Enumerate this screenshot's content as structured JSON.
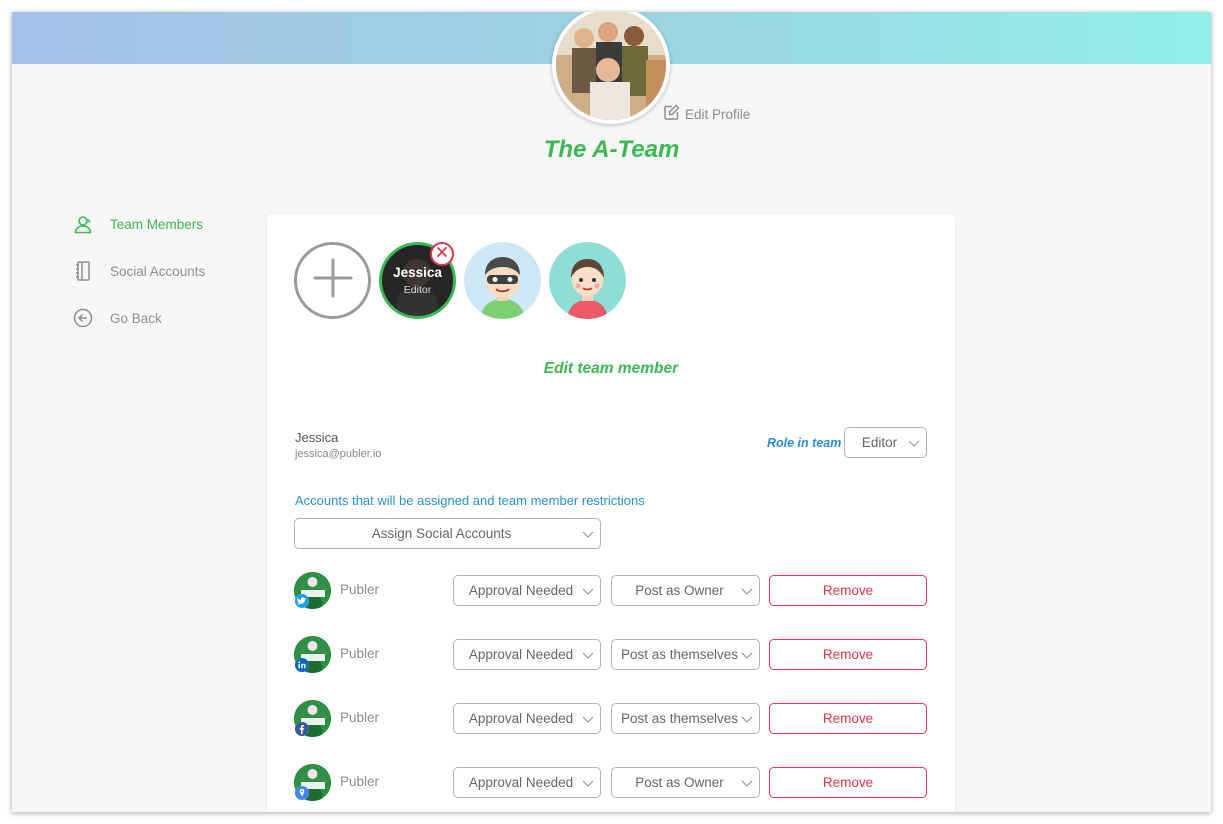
{
  "header": {
    "team_name": "The A-Team",
    "edit_profile_label": "Edit Profile"
  },
  "sidebar": {
    "items": [
      {
        "label": "Team Members",
        "icon": "user-icon",
        "active": true
      },
      {
        "label": "Social Accounts",
        "icon": "notebook-icon",
        "active": false
      },
      {
        "label": "Go Back",
        "icon": "arrow-left-circle-icon",
        "active": false
      }
    ]
  },
  "members": {
    "add_icon": "plus-circle-icon",
    "selected": {
      "name": "Jessica",
      "role": "Editor"
    }
  },
  "editor": {
    "title": "Edit team member",
    "member_name": "Jessica",
    "member_email": "jessica@publer.io",
    "role_label": "Role in team",
    "role_value": "Editor",
    "assign_label": "Accounts that will be assigned and team member restrictions",
    "assign_placeholder": "Assign Social Accounts"
  },
  "accounts": [
    {
      "name": "Publer",
      "network": "twitter-icon",
      "approval": "Approval Needed",
      "post_as": "Post as Owner",
      "remove_label": "Remove"
    },
    {
      "name": "Publer",
      "network": "linkedin-icon",
      "approval": "Approval Needed",
      "post_as": "Post as themselves",
      "remove_label": "Remove"
    },
    {
      "name": "Publer",
      "network": "facebook-icon",
      "approval": "Approval Needed",
      "post_as": "Post as themselves",
      "remove_label": "Remove"
    },
    {
      "name": "Publer",
      "network": "google-my-business-icon",
      "approval": "Approval Needed",
      "post_as": "Post as Owner",
      "remove_label": "Remove"
    }
  ],
  "colors": {
    "accent_green": "#3cb955",
    "link_blue": "#2b8fd6",
    "danger_red": "#e0344a",
    "banner_start": "#a5c1e8",
    "banner_end": "#92efe6"
  }
}
